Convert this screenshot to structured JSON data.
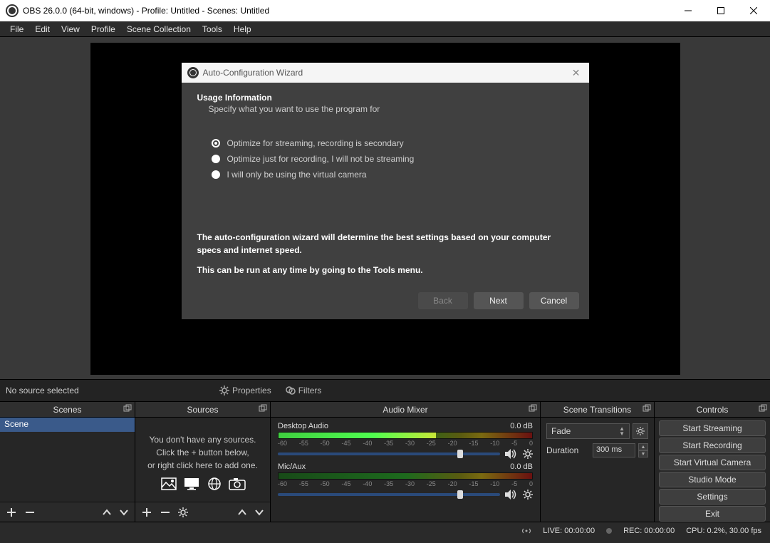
{
  "titlebar": {
    "title": "OBS 26.0.0 (64-bit, windows) - Profile: Untitled - Scenes: Untitled"
  },
  "menu": {
    "items": [
      "File",
      "Edit",
      "View",
      "Profile",
      "Scene Collection",
      "Tools",
      "Help"
    ]
  },
  "dialog": {
    "title": "Auto-Configuration Wizard",
    "heading": "Usage Information",
    "subheading": "Specify what you want to use the program for",
    "options": [
      {
        "label": "Optimize for streaming, recording is secondary",
        "selected": true
      },
      {
        "label": "Optimize just for recording, I will not be streaming",
        "selected": false
      },
      {
        "label": "I will only be using the virtual camera",
        "selected": false
      }
    ],
    "desc1": "The auto-configuration wizard will determine the best settings based on your computer specs and internet speed.",
    "desc2": "This can be run at any time by going to the Tools menu.",
    "buttons": {
      "back": "Back",
      "next": "Next",
      "cancel": "Cancel"
    }
  },
  "srcsel": {
    "label": "No source selected",
    "properties": "Properties",
    "filters": "Filters"
  },
  "docks": {
    "scenes": {
      "title": "Scenes",
      "items": [
        "Scene"
      ]
    },
    "sources": {
      "title": "Sources",
      "empty_l1": "You don't have any sources.",
      "empty_l2": "Click the + button below,",
      "empty_l3": "or right click here to add one."
    },
    "mixer": {
      "title": "Audio Mixer",
      "channels": [
        {
          "name": "Desktop Audio",
          "db": "0.0 dB",
          "ticks": [
            "-60",
            "-55",
            "-50",
            "-45",
            "-40",
            "-35",
            "-30",
            "-25",
            "-20",
            "-15",
            "-10",
            "-5",
            "0"
          ],
          "fill_pct": 62
        },
        {
          "name": "Mic/Aux",
          "db": "0.0 dB",
          "ticks": [
            "-60",
            "-55",
            "-50",
            "-45",
            "-40",
            "-35",
            "-30",
            "-25",
            "-20",
            "-15",
            "-10",
            "-5",
            "0"
          ],
          "fill_pct": 0
        }
      ]
    },
    "transitions": {
      "title": "Scene Transitions",
      "selected": "Fade",
      "duration_label": "Duration",
      "duration_value": "300 ms"
    },
    "controls": {
      "title": "Controls",
      "buttons": [
        "Start Streaming",
        "Start Recording",
        "Start Virtual Camera",
        "Studio Mode",
        "Settings",
        "Exit"
      ]
    }
  },
  "status": {
    "live": "LIVE: 00:00:00",
    "rec": "REC: 00:00:00",
    "cpu": "CPU: 0.2%, 30.00 fps"
  }
}
